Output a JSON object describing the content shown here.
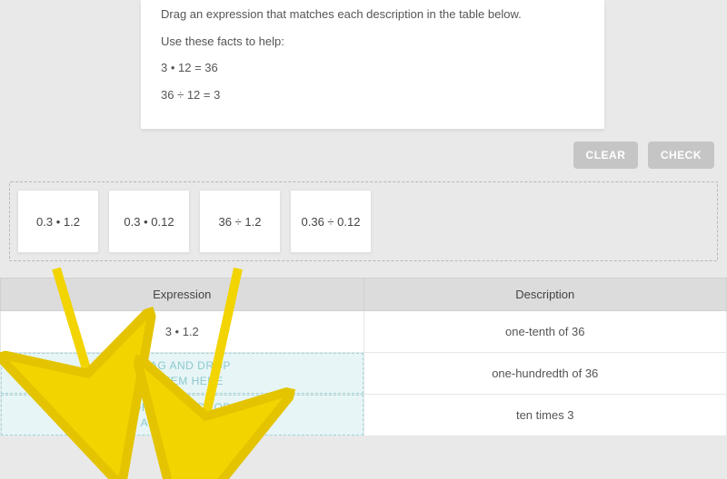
{
  "instructions": {
    "line1": "Drag an expression that matches each description in the table below.",
    "line2": "Use these facts to help:",
    "fact1": "3 • 12 = 36",
    "fact2": "36 ÷ 12 = 3"
  },
  "buttons": {
    "clear": "CLEAR",
    "check": "CHECK"
  },
  "tiles": [
    "0.3 • 1.2",
    "0.3 • 0.12",
    "36 ÷ 1.2",
    "0.36 ÷ 0.12"
  ],
  "table": {
    "headers": {
      "expression": "Expression",
      "description": "Description"
    },
    "rows": [
      {
        "expression": "3 • 1.2",
        "description": "one-tenth of 36",
        "isDrop": false
      },
      {
        "expression": "",
        "description": "one-hundredth of 36",
        "isDrop": true
      },
      {
        "expression": "",
        "description": "ten times 3",
        "isDrop": true
      }
    ],
    "dropzone_text": "DRAG AND DROP\nAN ITEM HERE"
  }
}
